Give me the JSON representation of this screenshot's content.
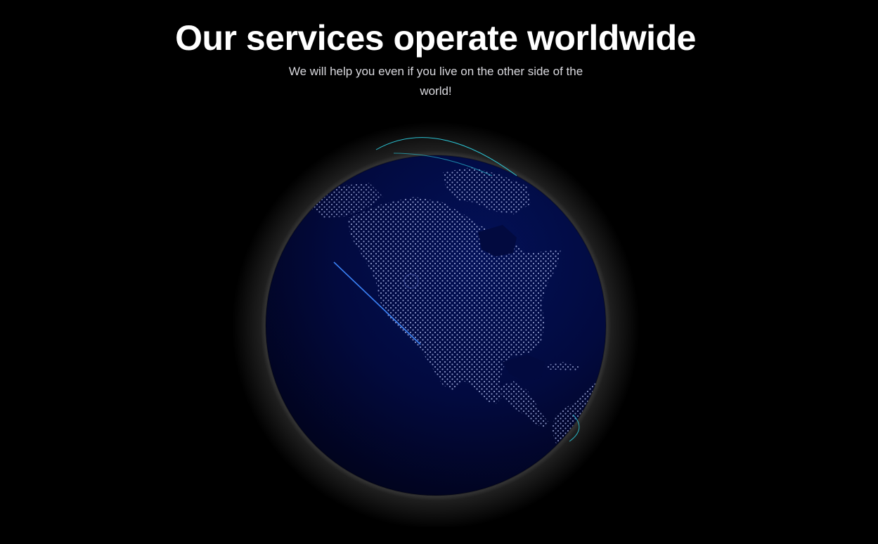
{
  "section": {
    "title": "Our services operate worldwide",
    "subtitle": "We will help you even if you live on the other side of the world!"
  },
  "globe": {
    "ocean_color": "#020a3f",
    "ocean_edge_color": "#01031c",
    "land_dot_color": "#9aa5d6",
    "arc_color": "#2dd4e6",
    "arc_secondary_color": "#3b82f6",
    "glow_color": "#ffffff"
  }
}
